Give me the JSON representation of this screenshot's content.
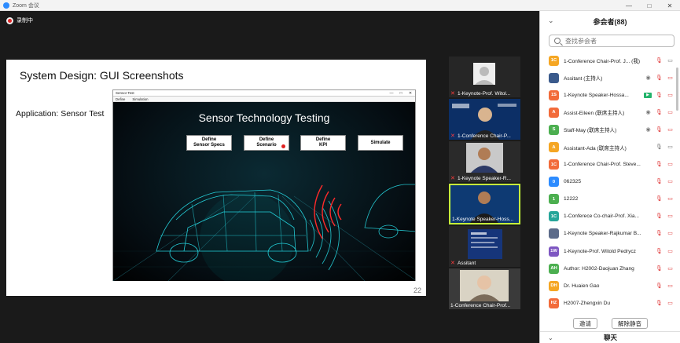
{
  "window": {
    "title": "Zoom 会议",
    "controls": [
      "—",
      "□",
      "✕"
    ]
  },
  "recording": {
    "label": "录制中"
  },
  "slide": {
    "title": "System Design: GUI Screenshots",
    "subtitle": "Application: Sensor Test",
    "page_number": "22",
    "app": {
      "title": "Sensor Test",
      "menu": [
        "Define",
        "Simulation"
      ],
      "controls": [
        "—",
        "□",
        "✕"
      ],
      "heading": "Sensor Technology Testing",
      "buttons": [
        {
          "label": "Define\nSensor Specs"
        },
        {
          "label": "Define\nScenario"
        },
        {
          "label": "Define\nKPI"
        },
        {
          "label": "Simulate"
        }
      ]
    }
  },
  "thumbnails": [
    {
      "label": "1-Keynote-Prof. Witol...",
      "muted": true
    },
    {
      "label": "1-Conference Chair-P...",
      "muted": true
    },
    {
      "label": "1-Keynote Speaker-R...",
      "muted": true
    },
    {
      "label": "1-Keynote Speaker-Hoss...",
      "muted": false,
      "active": true
    },
    {
      "label": "Assitant",
      "muted": true
    },
    {
      "label": "1-Conference Chair-Prof...",
      "muted": false
    }
  ],
  "participants_panel": {
    "title": "参会者(88)",
    "search_placeholder": "查找参会者",
    "participants": [
      {
        "initials": "1C",
        "color": "#f5a623",
        "name": "1-Conference Chair-Prof. J... (我)",
        "icons": "mic-muted cam"
      },
      {
        "initials": "",
        "color": "#3a5a8c",
        "name": "Assitant (主持人)",
        "icons": "eye mic-muted cam-muted"
      },
      {
        "initials": "1S",
        "color": "#f26b3a",
        "name": "1-Keynote Speaker-Hossa...",
        "icons": "share mic-muted cam-muted"
      },
      {
        "initials": "A",
        "color": "#f26b3a",
        "name": "Assist-Eileen (联席主持人)",
        "icons": "eye mic-muted cam-muted"
      },
      {
        "initials": "S",
        "color": "#4caf50",
        "name": "Staff-May (联席主持人)",
        "icons": "eye mic-muted cam-muted"
      },
      {
        "initials": "A",
        "color": "#f5a623",
        "name": "Assistant-Ada (联席主持人)",
        "icons": "mic cam"
      },
      {
        "initials": "1C",
        "color": "#f26b3a",
        "name": "1-Conference Chair-Prof. Steve...",
        "icons": "mic-muted cam-muted"
      },
      {
        "initials": "0",
        "color": "#2d8cff",
        "name": "062325",
        "icons": "mic-muted cam-muted"
      },
      {
        "initials": "1",
        "color": "#4caf50",
        "name": "12222",
        "icons": "mic-muted cam-muted"
      },
      {
        "initials": "1C",
        "color": "#26a69a",
        "name": "1-Conferece Co-chair-Prof. Xia...",
        "icons": "mic-muted cam-muted"
      },
      {
        "initials": "",
        "color": "#5c6b8a",
        "name": "1-Keynote Speaker-Rajkumar B...",
        "icons": "mic-muted cam-muted"
      },
      {
        "initials": "1W",
        "color": "#7e57c2",
        "name": "1-Keynote-Prof. Witold Pedrycz",
        "icons": "mic-muted cam-muted"
      },
      {
        "initials": "AH",
        "color": "#4caf50",
        "name": "Author: H2002-Daojuan Zhang",
        "icons": "mic-muted cam-muted"
      },
      {
        "initials": "DH",
        "color": "#f5a623",
        "name": "Dr. Huaien Gao",
        "icons": "mic-muted cam-muted"
      },
      {
        "initials": "HZ",
        "color": "#f26b3a",
        "name": "H2007-Zhengxin Du",
        "icons": "mic-muted cam-muted"
      }
    ],
    "invite_label": "邀请",
    "unmute_all_label": "解除静音",
    "chat_label": "聊天"
  }
}
